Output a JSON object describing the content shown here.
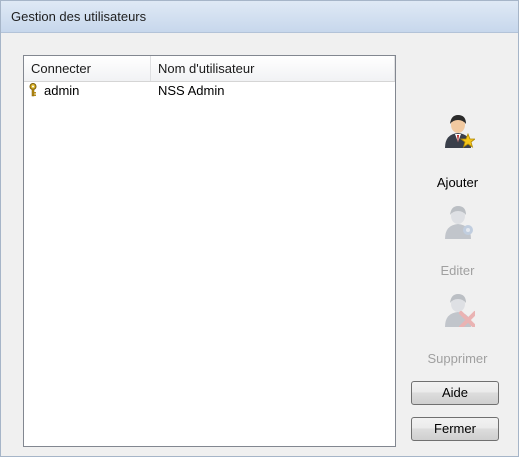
{
  "window": {
    "title": "Gestion des utilisateurs"
  },
  "users_list": {
    "columns": [
      "Connecter",
      "Nom d'utilisateur"
    ],
    "rows": [
      {
        "login": "admin",
        "username": "NSS Admin",
        "icon": "key-icon"
      }
    ]
  },
  "actions": {
    "add": {
      "label": "Ajouter",
      "icon": "user-add-icon",
      "enabled": true
    },
    "edit": {
      "label": "Editer",
      "icon": "user-edit-icon",
      "enabled": false
    },
    "delete": {
      "label": "Supprimer",
      "icon": "user-delete-icon",
      "enabled": false
    }
  },
  "buttons": {
    "help": "Aide",
    "close": "Fermer"
  },
  "colors": {
    "titlebar": "#c7d7ec",
    "dialog_bg": "#f0f0f0",
    "disabled_text": "#a0a0a0"
  }
}
